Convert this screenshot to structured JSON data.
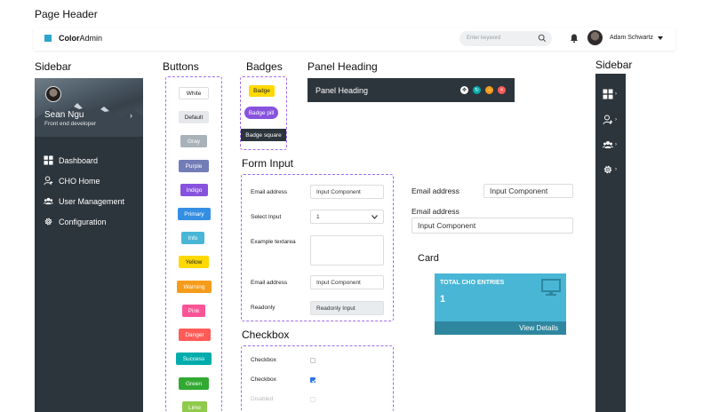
{
  "titles": {
    "page_header": "Page Header",
    "sidebar": "Sidebar",
    "buttons": "Buttons",
    "badges": "Badges",
    "panel_heading": "Panel Heading",
    "form_input": "Form Input",
    "card": "Card",
    "checkbox": "Checkbox",
    "right_sidebar": "Sidebar"
  },
  "header": {
    "logo_bold": "Color",
    "logo_rest": "Admin",
    "search_placeholder": "Enter keyword",
    "user_name": "Adam Schwartz"
  },
  "sidebar": {
    "profile_name": "Sean Ngu",
    "profile_role": "Front end developer",
    "items": [
      {
        "label": "Dashboard",
        "icon": "dashboard-icon"
      },
      {
        "label": "CHO Home",
        "icon": "user-icon"
      },
      {
        "label": "User Management",
        "icon": "users-icon"
      },
      {
        "label": "Configuration",
        "icon": "gear-icon"
      }
    ]
  },
  "buttons": [
    {
      "label": "White",
      "bg": "#ffffff",
      "fg": "#222222"
    },
    {
      "label": "Default",
      "bg": "#e6e8eb",
      "fg": "#222222"
    },
    {
      "label": "Gray",
      "bg": "#aab2b9",
      "fg": "#ffffff"
    },
    {
      "label": "Purple",
      "bg": "#727cb6",
      "fg": "#ffffff"
    },
    {
      "label": "Indigo",
      "bg": "#8753de",
      "fg": "#ffffff"
    },
    {
      "label": "Primary",
      "bg": "#348fe2",
      "fg": "#ffffff"
    },
    {
      "label": "Info",
      "bg": "#49b6d6",
      "fg": "#ffffff"
    },
    {
      "label": "Yellow",
      "bg": "#ffd900",
      "fg": "#222222"
    },
    {
      "label": "Warning",
      "bg": "#f59c1a",
      "fg": "#ffffff"
    },
    {
      "label": "Pink",
      "bg": "#fb5597",
      "fg": "#ffffff"
    },
    {
      "label": "Danger",
      "bg": "#ff5b57",
      "fg": "#ffffff"
    },
    {
      "label": "Success",
      "bg": "#00acac",
      "fg": "#ffffff"
    },
    {
      "label": "Green",
      "bg": "#32a932",
      "fg": "#ffffff"
    },
    {
      "label": "Lime",
      "bg": "#90ca4b",
      "fg": "#ffffff"
    }
  ],
  "badges": {
    "badge": "Badge",
    "badge_pill": "Badge pill",
    "badge_square": "Badge square"
  },
  "panel": {
    "title": "Panel Heading"
  },
  "form": {
    "email_label": "Email address",
    "email_value": "Input Component",
    "select_label": "Select Input",
    "select_value": "1",
    "textarea_label": "Example textarea",
    "email2_label": "Email address",
    "email2_value": "Input Component",
    "readonly_label": "Readonly",
    "readonly_value": "Readonly Input"
  },
  "form_side": {
    "email_label": "Email address",
    "email_value": "Input Component",
    "email2_label": "Email address",
    "email2_value": "Input Component"
  },
  "card": {
    "title": "TOTAL CHO ENTRIES",
    "value": "1",
    "footer": "View Details",
    "icon": "monitor-icon"
  },
  "checkbox": [
    {
      "label": "Checkbox",
      "checked": false
    },
    {
      "label": "Checkbox",
      "checked": true
    },
    {
      "label": "Disabled",
      "checked": false
    }
  ],
  "colors": {
    "sidebar_bg": "#2d353c",
    "accent": "#49b6d6",
    "dashed": "#a06cf0"
  }
}
